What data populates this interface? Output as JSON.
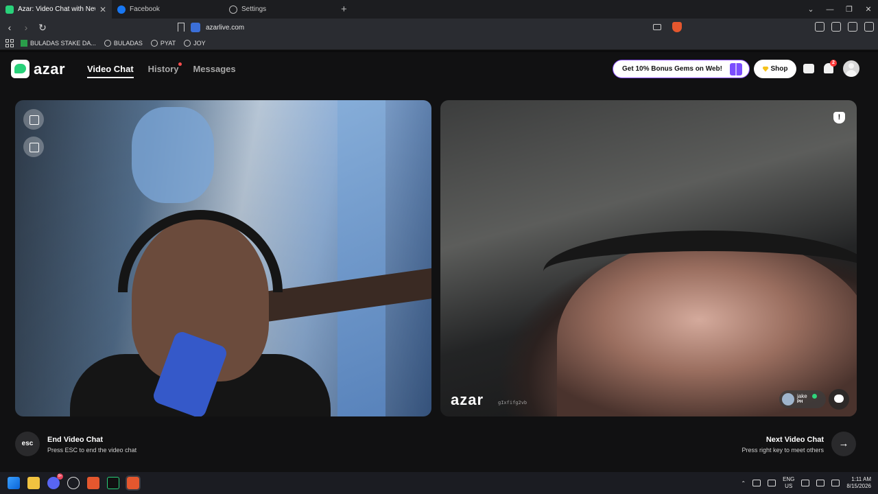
{
  "browser": {
    "tabs": [
      {
        "title": "Azar: Video Chat with New Pe",
        "active": true,
        "color": "#29d17a"
      },
      {
        "title": "Facebook",
        "active": false,
        "color": "#1877f2"
      },
      {
        "title": "Settings",
        "active": false,
        "color": "#9aa0a6"
      }
    ],
    "url": "azarlive.com",
    "bookmarks": [
      {
        "label": "BULADAS STAKE DA..."
      },
      {
        "label": "BULADAS"
      },
      {
        "label": "PYAT"
      },
      {
        "label": "JOY"
      }
    ]
  },
  "header": {
    "logo_text": "azar",
    "nav": {
      "video_chat": "Video Chat",
      "history": "History",
      "messages": "Messages"
    },
    "promo": "Get 10% Bonus Gems on Web!",
    "shop": "Shop",
    "notification_count": "2",
    "accent_color": "#29d17a"
  },
  "remote": {
    "watermark": "azar",
    "watermark_id": "gIxfifg2vb",
    "peer_name": "jake",
    "peer_country": "PH"
  },
  "controls": {
    "esc_label": "esc",
    "end_title": "End Video Chat",
    "end_subtitle": "Press ESC to end the video chat",
    "next_title": "Next Video Chat",
    "next_subtitle": "Press right key to meet others",
    "next_arrow": "→"
  },
  "taskbar": {
    "discord_badge": "9+",
    "lang_top": "ENG",
    "lang_bottom": "US",
    "time": "1:11 AM",
    "date": "8/15/2026"
  }
}
